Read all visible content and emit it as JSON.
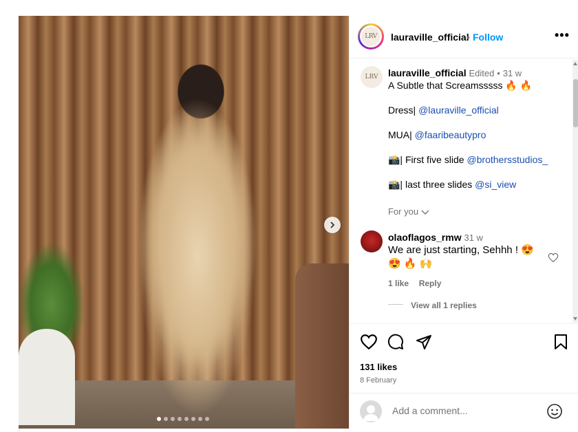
{
  "post": {
    "username": "lauraville_official",
    "follow_label": "Follow",
    "separator": "•",
    "more_label": "•••",
    "avatar_text": "LRV",
    "image_count": 8,
    "active_image": 1
  },
  "caption": {
    "username": "lauraville_official",
    "edited": "Edited",
    "separator": "•",
    "time": "31 w",
    "line1": "A Subtle that Screamsssss 🔥 🔥",
    "dress_prefix": "Dress| ",
    "dress_mention": "@lauraville_official",
    "mua_prefix": "MUA| ",
    "mua_mention": "@faaribeautypro",
    "slide1_prefix": "📸| First five slide ",
    "slide1_mention": "@brothersstudios_",
    "slide2_prefix": "📸| last three slides ",
    "slide2_mention": "@si_view",
    "for_you": "For you"
  },
  "comment": {
    "username": "olaoflagos_rmw",
    "time": "31 w",
    "text_line1": "We are just starting, Sehhh ! 😍",
    "text_line2": "😍 🔥 🙌",
    "likes": "1 like",
    "reply": "Reply",
    "view_replies": "View all 1 replies"
  },
  "actions": {
    "likes": "131 likes",
    "date": "8 February"
  },
  "add_comment": {
    "placeholder": "Add a comment..."
  },
  "colors": {
    "follow": "#0095f6",
    "mention": "#1a4fae",
    "muted": "#737373"
  }
}
